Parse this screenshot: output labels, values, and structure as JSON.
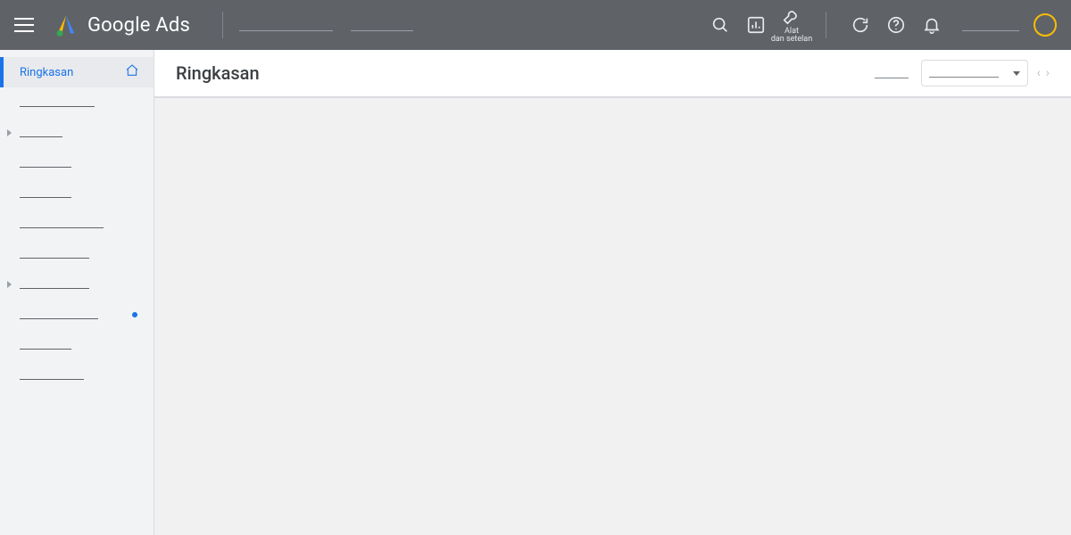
{
  "header": {
    "product_name": "Google Ads",
    "tools_label": "Alat\ndan setelan"
  },
  "sidebar": {
    "items": [
      {
        "label": "Ringkasan",
        "active": true,
        "home": true,
        "caret": false,
        "dot": false,
        "ghost_w": 0
      },
      {
        "label": "",
        "active": false,
        "home": false,
        "caret": false,
        "dot": false,
        "ghost_w": 84
      },
      {
        "label": "",
        "active": false,
        "home": false,
        "caret": true,
        "dot": false,
        "ghost_w": 48
      },
      {
        "label": "",
        "active": false,
        "home": false,
        "caret": false,
        "dot": false,
        "ghost_w": 58
      },
      {
        "label": "",
        "active": false,
        "home": false,
        "caret": false,
        "dot": false,
        "ghost_w": 58
      },
      {
        "label": "",
        "active": false,
        "home": false,
        "caret": false,
        "dot": false,
        "ghost_w": 94
      },
      {
        "label": "",
        "active": false,
        "home": false,
        "caret": false,
        "dot": false,
        "ghost_w": 78
      },
      {
        "label": "",
        "active": false,
        "home": false,
        "caret": true,
        "dot": false,
        "ghost_w": 78
      },
      {
        "label": "",
        "active": false,
        "home": false,
        "caret": false,
        "dot": true,
        "ghost_w": 88
      },
      {
        "label": "",
        "active": false,
        "home": false,
        "caret": false,
        "dot": false,
        "ghost_w": 58
      },
      {
        "label": "",
        "active": false,
        "home": false,
        "caret": false,
        "dot": false,
        "ghost_w": 72
      }
    ]
  },
  "page": {
    "title": "Ringkasan"
  }
}
